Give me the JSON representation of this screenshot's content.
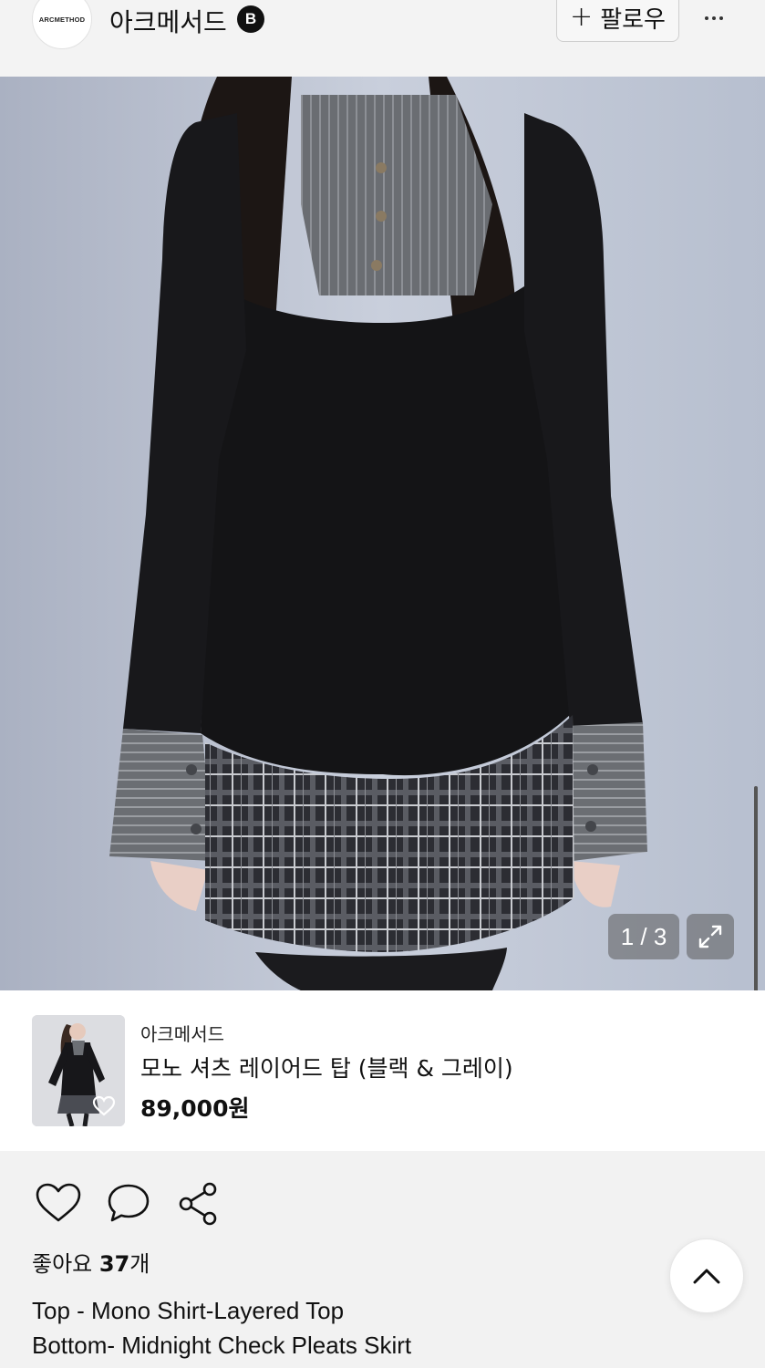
{
  "header": {
    "avatar_text": "ARCMETHOD",
    "brand_name": "아크메서드",
    "badge_letter": "B",
    "follow_plus": "+",
    "follow_label": "팔로우",
    "more_icon": "more-horizontal-icon"
  },
  "gallery": {
    "counter": "1 / 3",
    "expand_icon": "expand-icon"
  },
  "product": {
    "brand": "아크메서드",
    "name": "모노 셔츠 레이어드 탑 (블랙 & 그레이)",
    "price": "89,000원"
  },
  "actions": {
    "like_icon": "heart-icon",
    "comment_icon": "comment-icon",
    "share_icon": "share-icon",
    "likes_prefix": "좋아요 ",
    "likes_count": "37",
    "likes_suffix": "개",
    "description_line1": "Top - Mono Shirt-Layered Top",
    "description_line2": "Bottom- Midnight Check Pleats Skirt",
    "scroll_top_icon": "chevron-up-icon"
  },
  "colors": {
    "background": "#f2f2f2",
    "text": "#111111"
  }
}
